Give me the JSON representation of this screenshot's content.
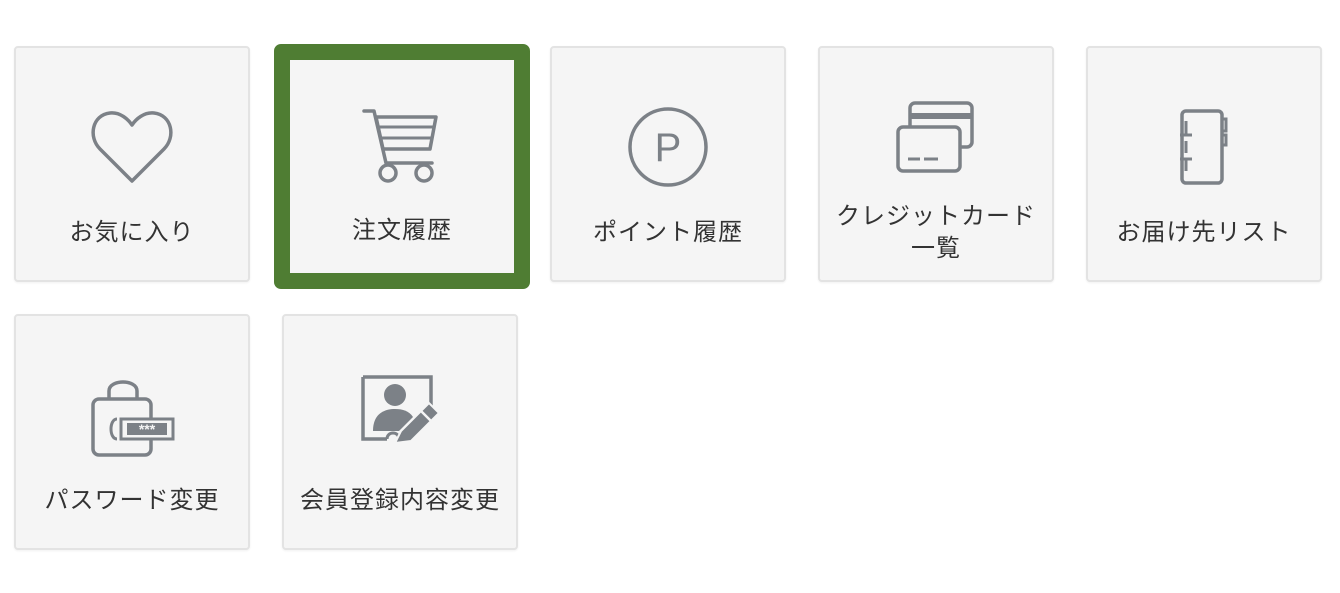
{
  "menu": {
    "items": [
      {
        "label": "お気に入り",
        "icon": "heart-icon"
      },
      {
        "label": "注文履歴",
        "icon": "cart-icon",
        "selected": true
      },
      {
        "label": "ポイント履歴",
        "icon": "point-icon",
        "icon_text": "P"
      },
      {
        "label": "クレジットカード一覧",
        "icon": "credit-card-icon"
      },
      {
        "label": "お届け先リスト",
        "icon": "address-book-icon"
      },
      {
        "label": "パスワード変更",
        "icon": "password-lock-icon",
        "icon_text": "***"
      },
      {
        "label": "会員登録内容変更",
        "icon": "profile-edit-icon"
      }
    ]
  },
  "colors": {
    "tile_background": "#f5f5f5",
    "tile_border": "#e3e3e3",
    "selected_border": "#4f7d33",
    "icon": "#7c8187",
    "label_text": "#333333"
  }
}
